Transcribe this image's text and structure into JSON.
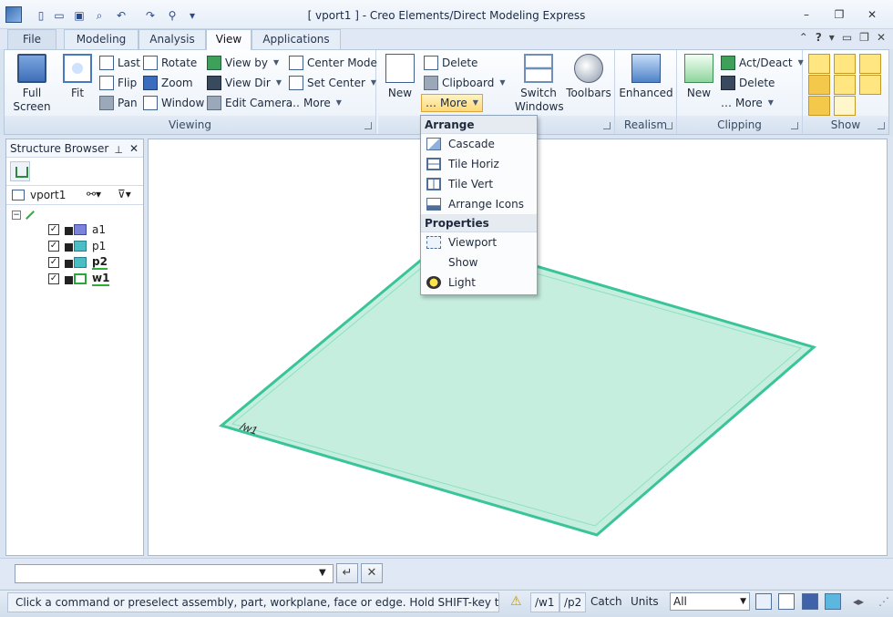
{
  "window": {
    "title": "[ vport1 ] - Creo Elements/Direct Modeling Express",
    "minimize": "–",
    "restore": "❐",
    "close": "✕"
  },
  "quick_access": {
    "qa_dropdown": "▾"
  },
  "tabs": [
    {
      "label": "File"
    },
    {
      "label": "Modeling"
    },
    {
      "label": "Analysis"
    },
    {
      "label": "View"
    },
    {
      "label": "Applications"
    }
  ],
  "tab_right": {
    "help": "?",
    "dd": "▾"
  },
  "ribbon": {
    "viewing": {
      "label": "Viewing",
      "full_screen": "Full Screen",
      "fit": "Fit",
      "last": "Last",
      "flip": "Flip",
      "pan": "Pan",
      "rotate": "Rotate",
      "zoom": "Zoom",
      "window": "Window",
      "view_by": "View by",
      "view_dir": "View Dir",
      "edit_camera": "Edit Camera",
      "center_mode": "Center Mode",
      "set_center": "Set Center",
      "more": "More"
    },
    "windows": {
      "new": "New",
      "delete": "Delete",
      "clipboard": "Clipboard",
      "more": "More",
      "switch_windows": "Switch Windows",
      "toolbars": "Toolbars"
    },
    "realism": {
      "label": "Realism",
      "enhanced": "Enhanced"
    },
    "clipping": {
      "label": "Clipping",
      "new": "New",
      "act_deact": "Act/Deact",
      "delete": "Delete",
      "more": "More"
    },
    "show": {
      "label": "Show"
    }
  },
  "dropdown_menu": {
    "arrange_header": "Arrange",
    "arrange_items": [
      "Cascade",
      "Tile Horiz",
      "Tile Vert",
      "Arrange Icons"
    ],
    "properties_header": "Properties",
    "properties_items": [
      "Viewport",
      "Show",
      "Light"
    ]
  },
  "structure_browser": {
    "title": "Structure Browser",
    "viewport": "vport1",
    "items": [
      {
        "name": "a1",
        "type": "assembly"
      },
      {
        "name": "p1",
        "type": "part"
      },
      {
        "name": "p2",
        "type": "part"
      },
      {
        "name": "w1",
        "type": "workplane"
      }
    ]
  },
  "viewport": {
    "workplane_label": "/w1",
    "plane_color": "#3ac49a"
  },
  "command_line": {
    "value": "",
    "enter": "↵",
    "cancel": "✕"
  },
  "status": {
    "message": "Click a command or preselect assembly, part, workplane, face or edge. Hold SHIFT-key to select m...",
    "workplane": "/w1",
    "part": "/p2",
    "catch": "Catch",
    "units": "Units",
    "filter": "All"
  }
}
